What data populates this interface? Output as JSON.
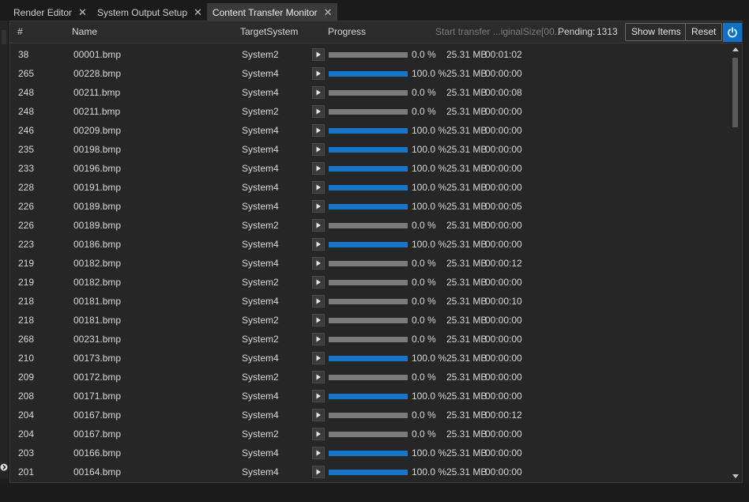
{
  "tabs": [
    {
      "label": "Render Editor",
      "active": false
    },
    {
      "label": "System Output Setup",
      "active": false
    },
    {
      "label": "Content Transfer Monitor",
      "active": true
    }
  ],
  "close_glyph": "✕",
  "header": {
    "num": "#",
    "name": "Name",
    "target": "TargetSystem",
    "progress": "Progress",
    "filter_placeholder": "Start transfer ...iginalSize[00...",
    "pending_label": "Pending:",
    "pending_count": "1313",
    "show_items": "Show Items",
    "reset": "Reset"
  },
  "colors": {
    "accent": "#1774c6",
    "bar_empty": "#7a7a7a"
  },
  "rows": [
    {
      "num": "38",
      "name": "00001.bmp",
      "target": "System2",
      "progress": 0,
      "pct": "0.0 %",
      "size": "25.31 MB",
      "time": "00:01:02"
    },
    {
      "num": "265",
      "name": "00228.bmp",
      "target": "System4",
      "progress": 100,
      "pct": "100.0 %",
      "size": "25.31 MB",
      "time": "00:00:00"
    },
    {
      "num": "248",
      "name": "00211.bmp",
      "target": "System4",
      "progress": 0,
      "pct": "0.0 %",
      "size": "25.31 MB",
      "time": "00:00:08"
    },
    {
      "num": "248",
      "name": "00211.bmp",
      "target": "System2",
      "progress": 0,
      "pct": "0.0 %",
      "size": "25.31 MB",
      "time": "00:00:00"
    },
    {
      "num": "246",
      "name": "00209.bmp",
      "target": "System4",
      "progress": 100,
      "pct": "100.0 %",
      "size": "25.31 MB",
      "time": "00:00:00"
    },
    {
      "num": "235",
      "name": "00198.bmp",
      "target": "System4",
      "progress": 100,
      "pct": "100.0 %",
      "size": "25.31 MB",
      "time": "00:00:00"
    },
    {
      "num": "233",
      "name": "00196.bmp",
      "target": "System4",
      "progress": 100,
      "pct": "100.0 %",
      "size": "25.31 MB",
      "time": "00:00:00"
    },
    {
      "num": "228",
      "name": "00191.bmp",
      "target": "System4",
      "progress": 100,
      "pct": "100.0 %",
      "size": "25.31 MB",
      "time": "00:00:00"
    },
    {
      "num": "226",
      "name": "00189.bmp",
      "target": "System4",
      "progress": 100,
      "pct": "100.0 %",
      "size": "25.31 MB",
      "time": "00:00:05"
    },
    {
      "num": "226",
      "name": "00189.bmp",
      "target": "System2",
      "progress": 0,
      "pct": "0.0 %",
      "size": "25.31 MB",
      "time": "00:00:00"
    },
    {
      "num": "223",
      "name": "00186.bmp",
      "target": "System4",
      "progress": 100,
      "pct": "100.0 %",
      "size": "25.31 MB",
      "time": "00:00:00"
    },
    {
      "num": "219",
      "name": "00182.bmp",
      "target": "System4",
      "progress": 0,
      "pct": "0.0 %",
      "size": "25.31 MB",
      "time": "00:00:12"
    },
    {
      "num": "219",
      "name": "00182.bmp",
      "target": "System2",
      "progress": 0,
      "pct": "0.0 %",
      "size": "25.31 MB",
      "time": "00:00:00"
    },
    {
      "num": "218",
      "name": "00181.bmp",
      "target": "System4",
      "progress": 0,
      "pct": "0.0 %",
      "size": "25.31 MB",
      "time": "00:00:10"
    },
    {
      "num": "218",
      "name": "00181.bmp",
      "target": "System2",
      "progress": 0,
      "pct": "0.0 %",
      "size": "25.31 MB",
      "time": "00:00:00"
    },
    {
      "num": "268",
      "name": "00231.bmp",
      "target": "System2",
      "progress": 0,
      "pct": "0.0 %",
      "size": "25.31 MB",
      "time": "00:00:00"
    },
    {
      "num": "210",
      "name": "00173.bmp",
      "target": "System4",
      "progress": 100,
      "pct": "100.0 %",
      "size": "25.31 MB",
      "time": "00:00:00"
    },
    {
      "num": "209",
      "name": "00172.bmp",
      "target": "System2",
      "progress": 0,
      "pct": "0.0 %",
      "size": "25.31 MB",
      "time": "00:00:00"
    },
    {
      "num": "208",
      "name": "00171.bmp",
      "target": "System4",
      "progress": 100,
      "pct": "100.0 %",
      "size": "25.31 MB",
      "time": "00:00:00"
    },
    {
      "num": "204",
      "name": "00167.bmp",
      "target": "System4",
      "progress": 0,
      "pct": "0.0 %",
      "size": "25.31 MB",
      "time": "00:00:12"
    },
    {
      "num": "204",
      "name": "00167.bmp",
      "target": "System2",
      "progress": 0,
      "pct": "0.0 %",
      "size": "25.31 MB",
      "time": "00:00:00"
    },
    {
      "num": "203",
      "name": "00166.bmp",
      "target": "System4",
      "progress": 100,
      "pct": "100.0 %",
      "size": "25.31 MB",
      "time": "00:00:00"
    },
    {
      "num": "201",
      "name": "00164.bmp",
      "target": "System4",
      "progress": 100,
      "pct": "100.0 %",
      "size": "25.31 MB",
      "time": "00:00:00"
    }
  ]
}
